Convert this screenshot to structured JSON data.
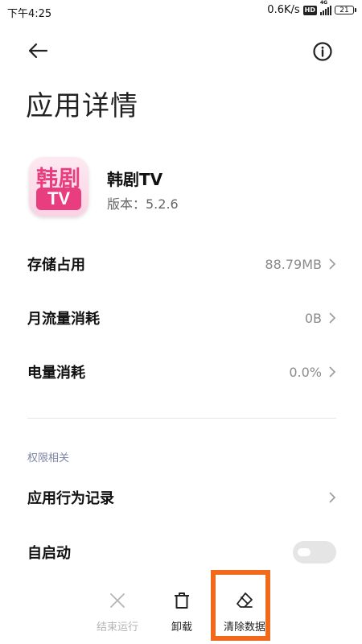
{
  "status_bar": {
    "time": "下午4:25",
    "network_speed": "0.6K/s",
    "hd_badge": "HD",
    "network_type": "4G",
    "battery": "21"
  },
  "header": {
    "back_icon": "arrow-left-icon",
    "info_icon": "info-circle-icon",
    "title": "应用详情"
  },
  "app": {
    "icon_text_top": "韩剧",
    "icon_text_bottom": "TV",
    "name": "韩剧TV",
    "version": "版本：5.2.6"
  },
  "rows": [
    {
      "label": "存储占用",
      "value": "88.79MB"
    },
    {
      "label": "月流量消耗",
      "value": "0B"
    },
    {
      "label": "电量消耗",
      "value": "0.0%"
    }
  ],
  "permissions": {
    "section_label": "权限相关",
    "behavior_record": "应用行为记录",
    "autostart": {
      "label": "自启动",
      "enabled": false
    }
  },
  "bottom_actions": {
    "stop": "结束运行",
    "uninstall": "卸载",
    "clear_data": "清除数据"
  },
  "colors": {
    "accent_pink": "#e83e80",
    "highlight_orange": "#f06a1d",
    "section_label": "#7d84a3"
  }
}
